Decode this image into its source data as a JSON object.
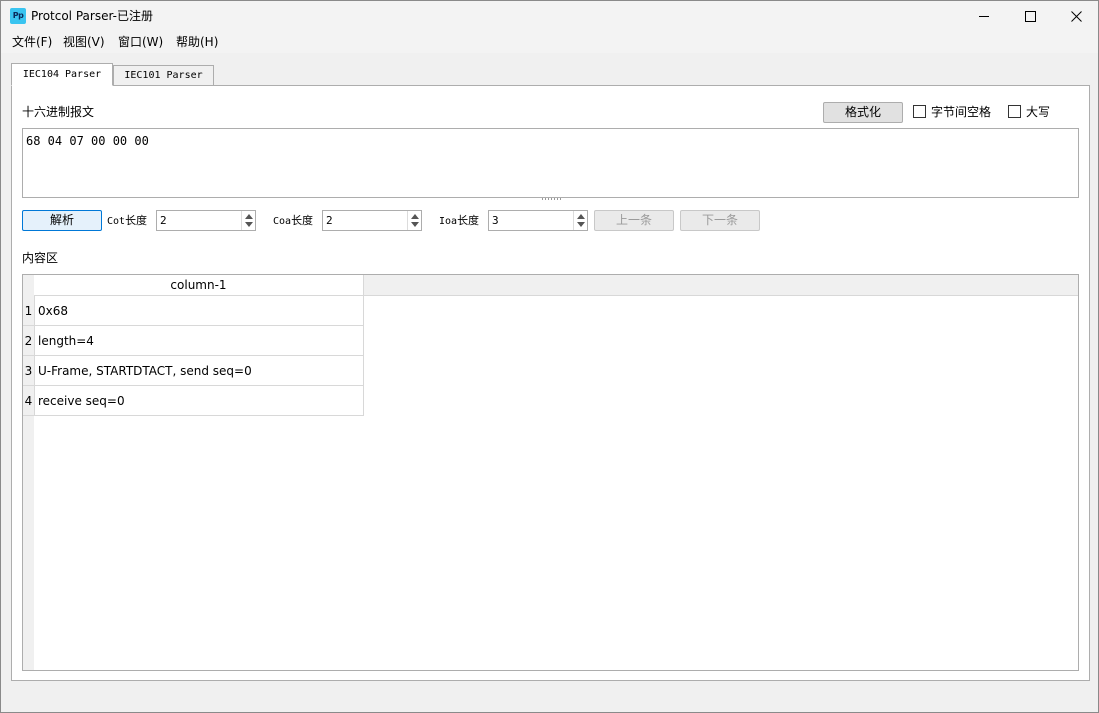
{
  "window": {
    "title": "Protcol Parser-已注册",
    "icon_text": "Pp"
  },
  "menu": [
    "文件(F)",
    "视图(V)",
    "窗口(W)",
    "帮助(H)"
  ],
  "tabs": [
    {
      "label": "IEC104 Parser",
      "active": true
    },
    {
      "label": "IEC101 Parser",
      "active": false
    }
  ],
  "hex_section": {
    "label": "十六进制报文",
    "format_button": "格式化",
    "byte_space_label": "字节间空格",
    "byte_space_checked": false,
    "uppercase_label": "大写",
    "uppercase_checked": false,
    "hex_value": "68 04 07 00 00 00"
  },
  "controls": {
    "parse_button": "解析",
    "cot": {
      "prefix": "Cot",
      "suffix": "长度",
      "value": "2"
    },
    "coa": {
      "prefix": "Coa",
      "suffix": "长度",
      "value": "2"
    },
    "ioa": {
      "prefix": "Ioa",
      "suffix": "长度",
      "value": "3"
    },
    "prev_button": "上一条",
    "next_button": "下一条"
  },
  "content": {
    "label": "内容区",
    "column_header": "column-1",
    "rows": [
      {
        "num": "1",
        "text": "0x68"
      },
      {
        "num": "2",
        "text": "length=4"
      },
      {
        "num": "3",
        "text": "U-Frame, STARTDTACT, send seq=0"
      },
      {
        "num": "4",
        "text": "receive seq=0"
      }
    ]
  },
  "icons": {
    "minimize": "minimize-icon",
    "maximize": "maximize-icon",
    "close": "close-icon"
  },
  "colors": {
    "accent": "#0078d7",
    "app_icon": "#39c4f0"
  }
}
